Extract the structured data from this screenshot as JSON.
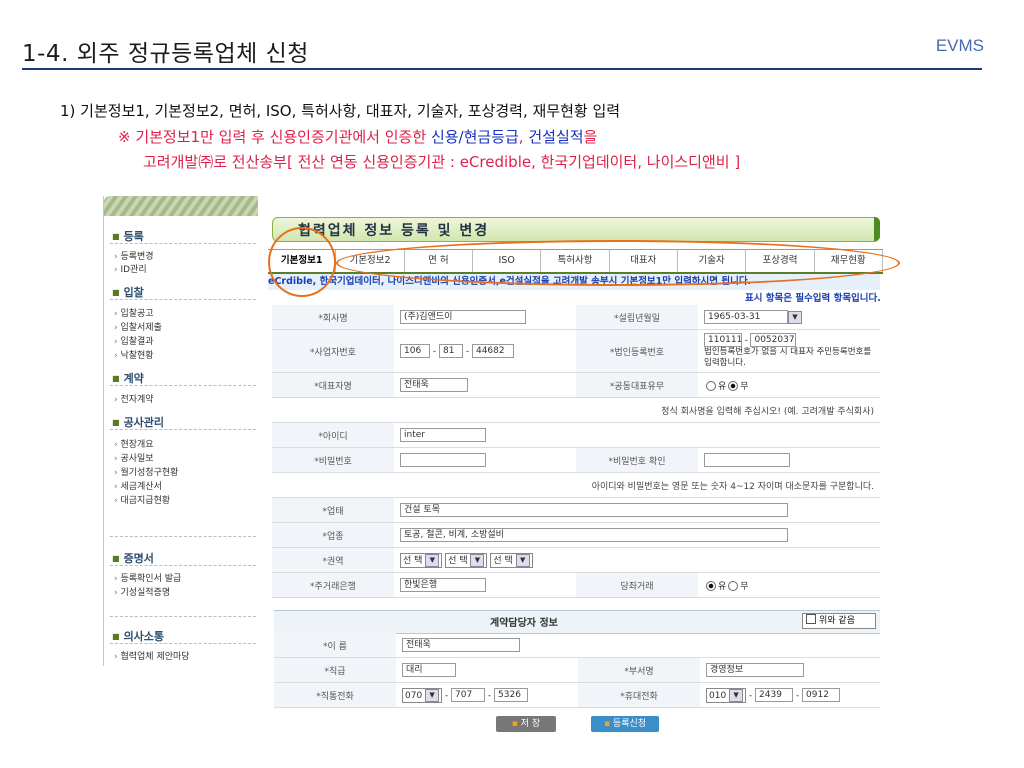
{
  "slide": {
    "title": "1-4. 외주 정규등록업체 신청",
    "brand": "EVMS",
    "bullet": "1)   기본정보1, 기본정보2, 면허, ISO, 특허사항, 대표자, 기술자, 포상경력, 재무현황 입력",
    "note1_a": "※ 기본정보1만 입력 후 신용인증기관에서 인증한 ",
    "note1_b": "신용/현금등급",
    "note1_c": ", ",
    "note1_d": "건설실적",
    "note1_e": "을",
    "note2": "고려개발㈜로 전산송부[ 전산 연동 신용인증기관 : eCredible, 한국기업데이터, 나이스디앤비 ]"
  },
  "sidebar": {
    "sections": [
      {
        "label": "등록",
        "items": [
          "등록변경",
          "ID관리"
        ]
      },
      {
        "label": "입찰",
        "items": [
          "입찰공고",
          "입찰서제출",
          "입찰결과",
          "낙찰현황"
        ]
      },
      {
        "label": "계약",
        "items": [
          "전자계약"
        ]
      },
      {
        "label": "공사관리",
        "items": [
          "현장개요",
          "공사일보",
          "월기성청구현황",
          "세금계산서",
          "대금지급현황"
        ]
      },
      {
        "label": "증명서",
        "items": [
          "등록확인서 발급",
          "기성실적증명"
        ]
      },
      {
        "label": "의사소통",
        "items": [
          "협력업체 제안마당"
        ]
      }
    ]
  },
  "form": {
    "banner_title": "협력업체 정보 등록 및 변경",
    "tabs": [
      "기본정보1",
      "기본정보2",
      "면 허",
      "ISO",
      "특허사항",
      "대표자",
      "기술자",
      "포상경력",
      "재무현황"
    ],
    "notice": "eCrdible, 한국기업데이터, 나이스디앤비의 신용인증서,e건설실적을 고려개발 송부시 기본정보1만 입력하시면 됩니다.",
    "required_note": "표시 항목은 필수입력 항목입니다.",
    "company_label": "*회사명",
    "company_value": "(주)김앤드이",
    "founded_label": "*설립년월일",
    "founded_value": "1965-03-31",
    "bizno_label": "*사업자번호",
    "bizno_1": "106",
    "bizno_2": "81",
    "bizno_3": "44682",
    "corpno_label": "*법인등록번호",
    "corpno_1": "110111",
    "corpno_2": "0052037",
    "corpno_hint": "법인등록번호가 없을 시 대표자 주민등록번호를 입력합니다.",
    "ceo_label": "*대표자명",
    "ceo_value": "전태욱",
    "joint_label": "*공동대표유무",
    "joint_yes": "유",
    "joint_no": "무",
    "company_hint": "정식 회사명을 입력해 주십시오! (예. 고려개발 주식회사)",
    "id_label": "*아이디",
    "id_value": "inter",
    "pw_label": "*비밀번호",
    "pw_confirm_label": "*비밀번호 확인",
    "pw_hint": "아이디와 비밀번호는 영문 또는 숫자 4~12 자이며 대소문자를 구분합니다.",
    "biztype_label": "*업태",
    "biztype_value": "건설 토목",
    "bizitem_label": "*업종",
    "bizitem_value": "토공, 철콘, 비계, 소방설비",
    "region_label": "*권역",
    "region_select": "선 택",
    "bank_label": "*주거래은행",
    "bank_value": "한빛은행",
    "current_label": "당좌거래",
    "current_yes": "유",
    "current_no": "무"
  },
  "contact": {
    "title": "계약담당자 정보",
    "same_label": "위와 같음",
    "name_label": "*이 름",
    "name_value": "전태욱",
    "rank_label": "*직급",
    "rank_value": "대리",
    "dept_label": "*부서명",
    "dept_value": "경영정보",
    "tel_label": "*직통전화",
    "tel_1": "070",
    "tel_2": "707",
    "tel_3": "5326",
    "mobile_label": "*휴대전화",
    "mobile_1": "010",
    "mobile_2": "2439",
    "mobile_3": "0912"
  },
  "buttons": {
    "save": "저 장",
    "submit": "등록신청"
  }
}
